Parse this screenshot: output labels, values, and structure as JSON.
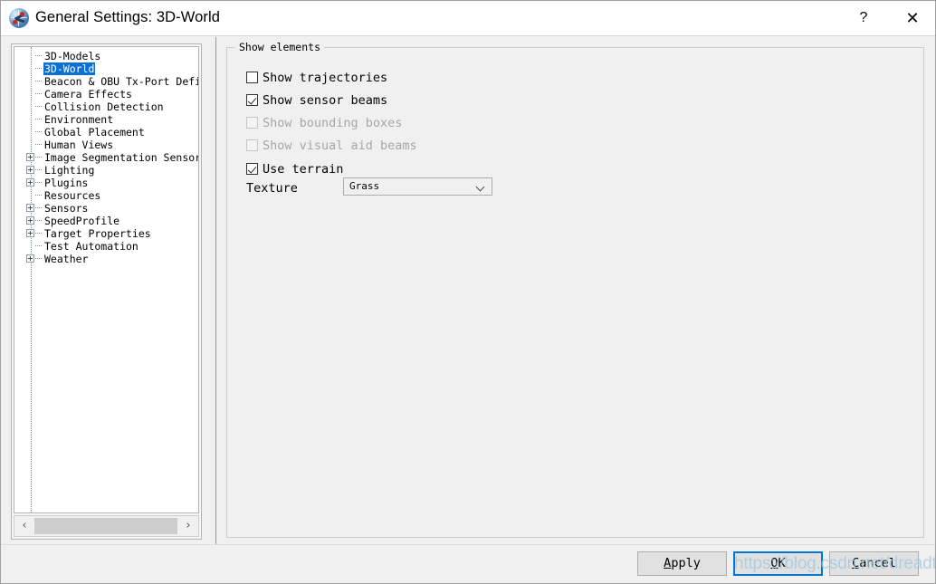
{
  "window": {
    "title": "General Settings: 3D-World",
    "icon": "globe-3d-icon",
    "help_label": "?",
    "close_label": "✕"
  },
  "tree": {
    "items": [
      {
        "label": "3D-Models",
        "expandable": false,
        "selected": false
      },
      {
        "label": "3D-World",
        "expandable": false,
        "selected": true
      },
      {
        "label": "Beacon & OBU Tx-Port Definitio",
        "expandable": false,
        "selected": false
      },
      {
        "label": "Camera Effects",
        "expandable": false,
        "selected": false
      },
      {
        "label": "Collision Detection",
        "expandable": false,
        "selected": false
      },
      {
        "label": "Environment",
        "expandable": false,
        "selected": false
      },
      {
        "label": "Global Placement",
        "expandable": false,
        "selected": false
      },
      {
        "label": "Human Views",
        "expandable": false,
        "selected": false
      },
      {
        "label": "Image Segmentation Sensor",
        "expandable": true,
        "selected": false
      },
      {
        "label": "Lighting",
        "expandable": true,
        "selected": false
      },
      {
        "label": "Plugins",
        "expandable": true,
        "selected": false
      },
      {
        "label": "Resources",
        "expandable": false,
        "selected": false
      },
      {
        "label": "Sensors",
        "expandable": true,
        "selected": false
      },
      {
        "label": "SpeedProfile",
        "expandable": true,
        "selected": false
      },
      {
        "label": "Target Properties",
        "expandable": true,
        "selected": false
      },
      {
        "label": "Test Automation",
        "expandable": false,
        "selected": false
      },
      {
        "label": "Weather",
        "expandable": true,
        "selected": false
      }
    ],
    "scrollbar": {
      "left_arrow": "‹",
      "right_arrow": "›"
    }
  },
  "panel": {
    "group_title": "Show elements",
    "checkboxes": [
      {
        "label": "Show trajectories",
        "checked": false,
        "disabled": false
      },
      {
        "label": "Show sensor beams",
        "checked": true,
        "disabled": false
      },
      {
        "label": "Show bounding boxes",
        "checked": false,
        "disabled": true
      },
      {
        "label": "Show visual aid beams",
        "checked": false,
        "disabled": true
      },
      {
        "label": "Use terrain",
        "checked": true,
        "disabled": false
      }
    ],
    "texture": {
      "label": "Texture",
      "value": "Grass"
    }
  },
  "buttons": {
    "apply": {
      "accel": "A",
      "rest": "pply"
    },
    "ok": {
      "accel": "O",
      "rest": "K"
    },
    "cancel": {
      "accel": "C",
      "rest": "ancel"
    }
  },
  "watermark": "https://blog.csdn.net/dreadtumn",
  "colors": {
    "selection": "#0a6fd6",
    "focus_border": "#0078d7",
    "window_bg": "#f0f0f0"
  }
}
